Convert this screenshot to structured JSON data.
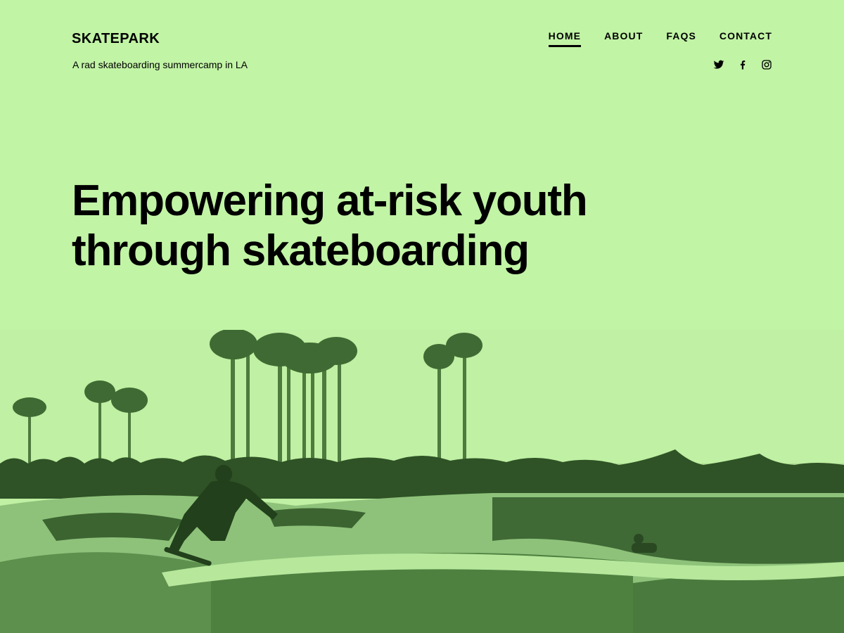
{
  "site": {
    "title": "SKATEPARK",
    "tagline": "A rad skateboarding summercamp in LA"
  },
  "nav": {
    "items": [
      {
        "label": "HOME",
        "active": true
      },
      {
        "label": "ABOUT"
      },
      {
        "label": "FAQS"
      },
      {
        "label": "CONTACT"
      }
    ]
  },
  "social": {
    "icons": [
      "twitter-icon",
      "facebook-icon",
      "instagram-icon"
    ]
  },
  "hero": {
    "heading_line1": "Empowering at-risk youth",
    "heading_line2": "through skateboarding"
  },
  "colors": {
    "background": "#c1f4a5",
    "text": "#000000",
    "image_duotone_dark": "#1f3a1a",
    "image_duotone_light": "#c1f4a5"
  }
}
